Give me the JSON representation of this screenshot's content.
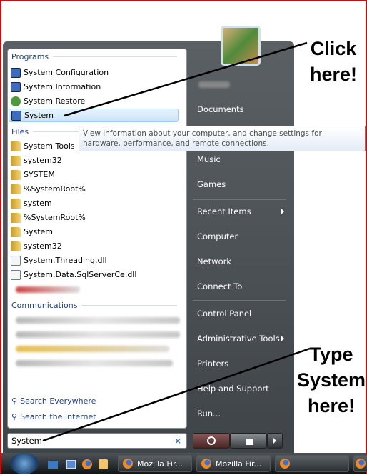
{
  "programs": {
    "header": "Programs",
    "items": [
      {
        "label": "System Configuration"
      },
      {
        "label": "System Information"
      },
      {
        "label": "System Restore"
      },
      {
        "label": "System",
        "selected": true
      }
    ]
  },
  "files": {
    "header": "Files",
    "items": [
      "System Tools",
      "system32",
      "SYSTEM",
      "%SystemRoot%",
      "system",
      "%SystemRoot%",
      "System",
      "system32",
      "System.Threading.dll",
      "System.Data.SqlServerCe.dll"
    ]
  },
  "communications": {
    "header": "Communications"
  },
  "tooltip": "View information about your computer, and change settings for hardware, performance, and remote connections.",
  "search_everywhere": "Search Everywhere",
  "search_internet": "Search the Internet",
  "search": {
    "value": "System",
    "clear": "×"
  },
  "right": {
    "items": [
      "Documents",
      "Music",
      "Games",
      "Recent Items",
      "Computer",
      "Network",
      "Connect To",
      "Control Panel",
      "Administrative Tools",
      "Printers",
      "Help and Support",
      "Run..."
    ]
  },
  "taskbar": {
    "buttons": [
      "Mozilla Fir...",
      "Mozilla Fir..."
    ]
  },
  "notes": {
    "click": "Click here!",
    "type": "Type System here!"
  }
}
